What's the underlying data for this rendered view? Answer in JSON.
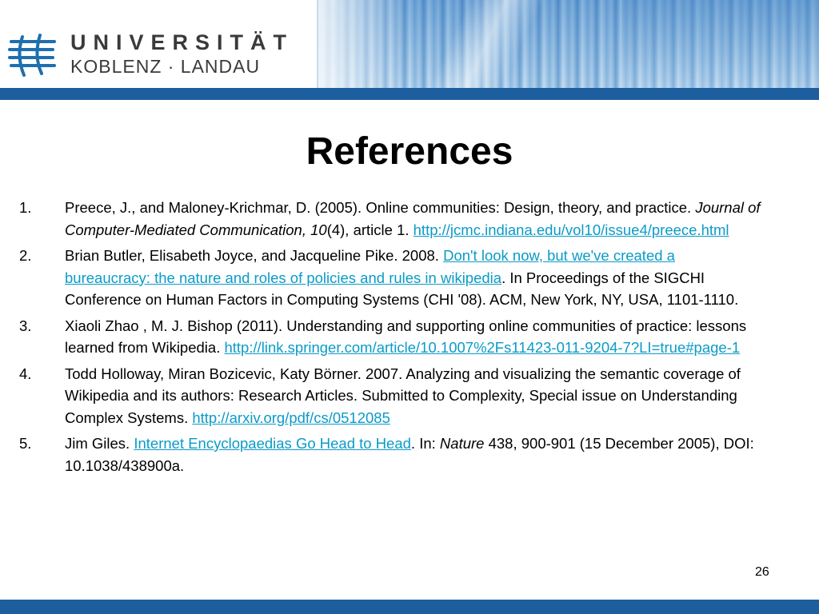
{
  "header": {
    "university_line1": "UNIVERSITÄT",
    "university_line2": "KOBLENZ · LANDAU",
    "logo_icon": "university-logo-icon",
    "colors": {
      "brand_blue": "#1d5f9e",
      "link": "#0b9bc7"
    }
  },
  "slide": {
    "title": "References",
    "page_number": "26"
  },
  "references": [
    {
      "number": "1.",
      "segments": [
        {
          "text": "Preece, J., and Maloney-Krichmar, D. (2005). Online communities: Design, theory, and practice.  "
        },
        {
          "text": "Journal of Computer-Mediated Communication, 10",
          "style": "italic"
        },
        {
          "text": "(4), article 1. "
        },
        {
          "text": "http://jcmc.indiana.edu/vol10/issue4/preece.html",
          "style": "link"
        }
      ]
    },
    {
      "number": "2.",
      "segments": [
        {
          "text": "Brian Butler, Elisabeth Joyce, and Jacqueline Pike. 2008. "
        },
        {
          "text": "Don't look now, but we've created a bureaucracy: the nature and roles of policies and rules in wikipedia",
          "style": "link"
        },
        {
          "text": ". In Proceedings of the SIGCHI Conference on Human Factors in Computing Systems (CHI '08). ACM, New York, NY, USA, 1101-1110."
        }
      ]
    },
    {
      "number": "3.",
      "segments": [
        {
          "text": "Xiaoli Zhao , M. J. Bishop (2011). Understanding and supporting online communities of practice: lessons learned from Wikipedia. "
        },
        {
          "text": "http://link.springer.com/article/10.1007%2Fs11423-011-9204-7?LI=true#page-1",
          "style": "link"
        }
      ]
    },
    {
      "number": "4.",
      "segments": [
        {
          "text": "Todd Holloway, Miran Bozicevic, Katy Börner. 2007. Analyzing and visualizing the semantic coverage of Wikipedia and its authors: Research Articles. Submitted to Complexity, Special issue on Understanding Complex Systems. "
        },
        {
          "text": "http://arxiv.org/pdf/cs/0512085",
          "style": "link"
        }
      ]
    },
    {
      "number": "5.",
      "segments": [
        {
          "text": "Jim Giles. "
        },
        {
          "text": "Internet Encyclopaedias Go Head to Head",
          "style": "link"
        },
        {
          "text": ". In: "
        },
        {
          "text": "Nature",
          "style": "italic"
        },
        {
          "text": " 438, 900-901 (15 December 2005), DOI: 10.1038/438900a."
        }
      ]
    }
  ]
}
